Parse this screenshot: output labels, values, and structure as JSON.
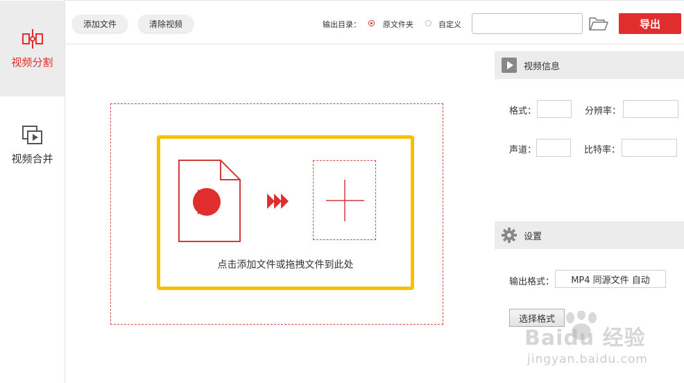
{
  "sidebar": {
    "items": [
      {
        "label": "视频分割",
        "icon": "split-icon",
        "active": true
      },
      {
        "label": "视频合并",
        "icon": "merge-icon",
        "active": false
      }
    ]
  },
  "toolbar": {
    "add_label": "添加文件",
    "clear_label": "清除视频",
    "output_dir_label": "输出目录：",
    "radio_source": "原文件夹",
    "radio_custom": "自定义",
    "selected_radio": "原文件夹",
    "path_value": "",
    "path_placeholder": "",
    "export_label": "导出"
  },
  "dropzone": {
    "hint": "点击添加文件或拖拽文件到此处"
  },
  "video_info": {
    "title": "视频信息",
    "format_label": "格式：",
    "resolution_label": "分辨率：",
    "channel_label": "声道：",
    "bitrate_label": "比特率："
  },
  "settings": {
    "title": "设置",
    "output_format_label": "输出格式：",
    "output_format_value": "MP4 同源文件 自动",
    "choose_format_label": "选择格式"
  },
  "watermark": {
    "brand": "Baidu 经验",
    "url": "jingyan.baidu.com"
  },
  "colors": {
    "accent": "#e02e2e",
    "highlight": "#f7c000",
    "panel_bg": "#ececec"
  }
}
